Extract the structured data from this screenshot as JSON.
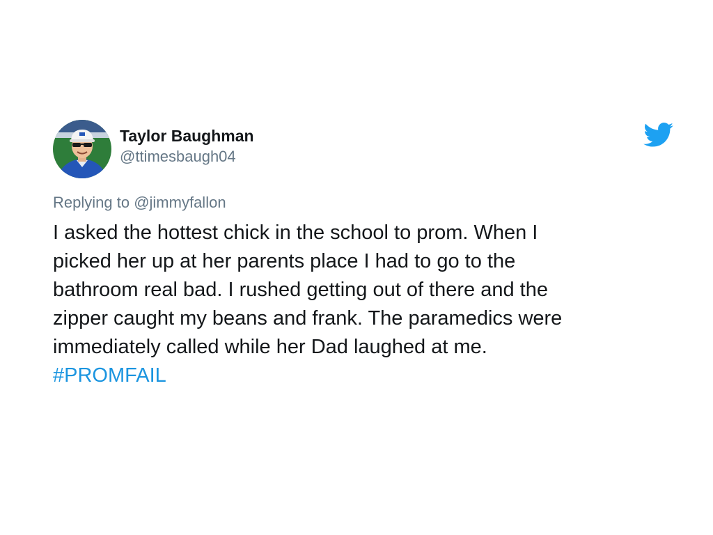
{
  "tweet": {
    "author": {
      "display_name": "Taylor Baughman",
      "handle": "@ttimesbaugh04",
      "avatar_icon": "user-avatar-photo"
    },
    "brand_icon": "twitter-bird-icon",
    "brand_color": "#1DA1F2",
    "reply": {
      "prefix": "Replying to",
      "handle": "@jimmyfallon"
    },
    "body_lines": [
      "I asked the hottest chick in the school to prom. When I",
      "picked her up at her parents place I had to go to the",
      "bathroom real bad. I rushed getting out of there and the",
      "zipper caught my beans and frank. The paramedics were",
      "immediately called while her Dad laughed at me."
    ],
    "hashtag": "#PROMFAIL",
    "link_color": "#1B95E0"
  }
}
